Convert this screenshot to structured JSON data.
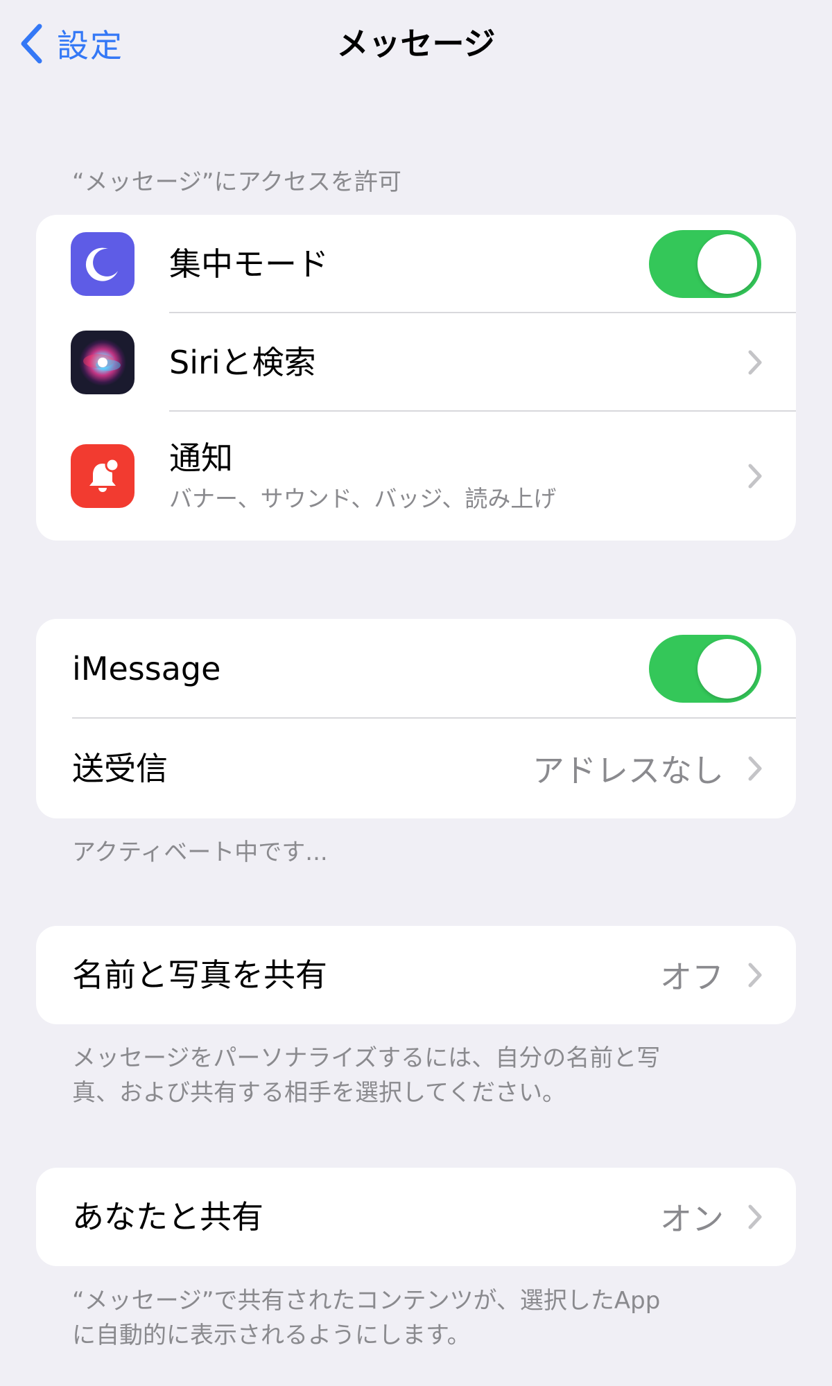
{
  "nav": {
    "back_label": "設定",
    "title": "メッセージ"
  },
  "access_section": {
    "header": "“メッセージ”にアクセスを許可",
    "items": [
      {
        "label": "集中モード",
        "control": "toggle",
        "toggle_on": true,
        "icon": "moon-icon"
      },
      {
        "label": "Siriと検索",
        "control": "chevron",
        "icon": "siri-icon"
      },
      {
        "label": "通知",
        "sublabel": "バナー、サウンド、バッジ、読み上げ",
        "control": "chevron",
        "icon": "bell-icon"
      }
    ]
  },
  "imessage_section": {
    "items": [
      {
        "label": "iMessage",
        "control": "toggle",
        "toggle_on": true
      },
      {
        "label": "送受信",
        "value": "アドレスなし",
        "control": "chevron"
      }
    ],
    "footer": "アクティベート中です..."
  },
  "share_name_section": {
    "label": "名前と写真を共有",
    "value": "オフ",
    "footer_line1": "メッセージをパーソナライズするには、自分の名前と写",
    "footer_line2": "真、および共有する相手を選択してください。"
  },
  "shared_with_you_section": {
    "label": "あなたと共有",
    "value": "オン",
    "footer_line1": "“メッセージ”で共有されたコンテンツが、選択したApp",
    "footer_line2": "に自動的に表示されるようにします。"
  },
  "colors": {
    "background": "#f0eff5",
    "accent": "#3478f6",
    "toggle_on": "#34c759",
    "secondary_text": "#8a8a8e"
  }
}
